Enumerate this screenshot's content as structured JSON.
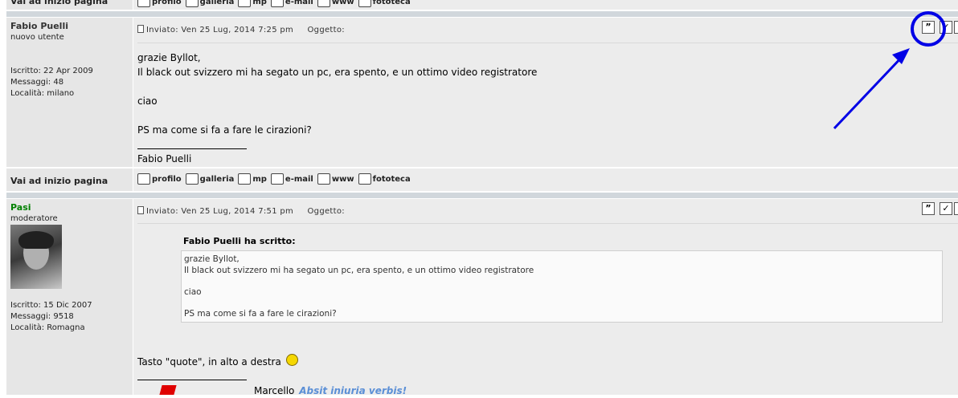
{
  "top_row": {
    "back_to_top": "Vai ad inizio pagina",
    "links": [
      {
        "label": "profilo",
        "icon": "profile-icon"
      },
      {
        "label": "galleria",
        "icon": "gallery-icon"
      },
      {
        "label": "mp",
        "icon": "envelope-icon"
      },
      {
        "label": "e-mail",
        "icon": "email-icon"
      },
      {
        "label": "www",
        "icon": "home-icon"
      },
      {
        "label": "fototeca",
        "icon": "trophy-icon"
      }
    ]
  },
  "post1": {
    "author": "Fabio Puelli",
    "rank": "nuovo utente",
    "joined": "Iscritto: 22 Apr 2009",
    "messages": "Messaggi: 48",
    "location": "Località: milano",
    "posted": "Inviato: Ven 25 Lug, 2014 7:25 pm",
    "subject": "Oggetto:",
    "lines": [
      "grazie Byllot,",
      "Il black out svizzero mi ha segato un pc, era spento, e un ottimo video registratore",
      "ciao",
      "PS ma come si fa a fare le cirazioni?"
    ],
    "signature": "Fabio Puelli",
    "quote_button": "”"
  },
  "middle_row": {
    "back_to_top": "Vai ad inizio pagina",
    "links": [
      {
        "label": "profilo",
        "icon": "profile-icon"
      },
      {
        "label": "galleria",
        "icon": "gallery-icon"
      },
      {
        "label": "mp",
        "icon": "envelope-icon"
      },
      {
        "label": "e-mail",
        "icon": "email-icon"
      },
      {
        "label": "www",
        "icon": "home-icon"
      },
      {
        "label": "fototeca",
        "icon": "trophy-icon"
      }
    ]
  },
  "post2": {
    "author": "Pasi",
    "author_color": "#008000",
    "rank": "moderatore",
    "joined": "Iscritto: 15 Dic 2007",
    "messages": "Messaggi: 9518",
    "location": "Località: Romagna",
    "posted": "Inviato: Ven 25 Lug, 2014 7:51 pm",
    "subject": "Oggetto:",
    "quote_title": "Fabio Puelli ha scritto:",
    "quote_lines": [
      "grazie Byllot,",
      "Il black out svizzero mi ha segato un pc, era spento, e un ottimo video registratore",
      "ciao",
      "PS ma come si fa a fare le cirazioni?"
    ],
    "reply": "Tasto \"quote\", in alto a destra",
    "sig_name": "Marcello",
    "sig_motto": "Absit iniuria verbis!"
  },
  "annotation_color": "#0000e6"
}
